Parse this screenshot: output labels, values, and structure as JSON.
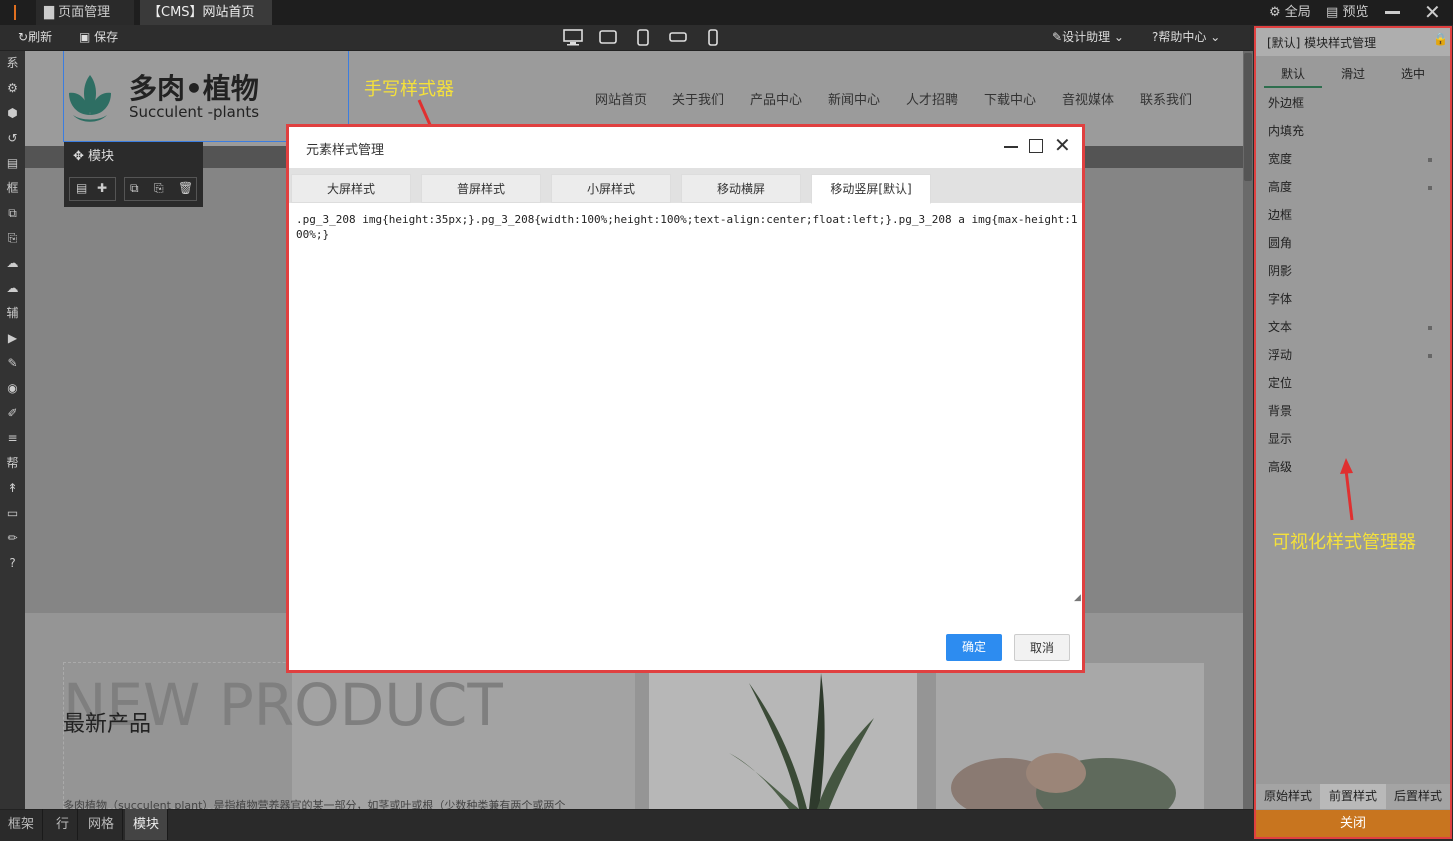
{
  "titlebar": {
    "tabs": [
      {
        "label": "页面管理",
        "icon": "file-icon"
      },
      {
        "label": "【CMS】网站首页",
        "icon": "close-circle-icon"
      }
    ],
    "global_label": "全局",
    "preview_label": "预览"
  },
  "toolbar": {
    "refresh_label": "刷新",
    "save_label": "保存",
    "design_assist_label": "设计助理",
    "help_center_label": "帮助中心",
    "devices": [
      "desktop-icon",
      "tablet-landscape-icon",
      "tablet-portrait-icon",
      "phone-landscape-icon",
      "phone-portrait-icon"
    ]
  },
  "leftbar": {
    "items": [
      "系",
      "⚙",
      "⬢",
      "↺",
      "▤",
      "框",
      "⧉",
      "⎘",
      "☁",
      "☁",
      "辅",
      "▶",
      "✎",
      "◉",
      "✐",
      "≡",
      "帮",
      "↟",
      "▭",
      "✏",
      "?"
    ]
  },
  "site": {
    "logo_title": "多肉•植物",
    "logo_subtitle": "Succulent -plants",
    "nav": [
      "网站首页",
      "关于我们",
      "产品中心",
      "新闻中心",
      "人才招聘",
      "下载中心",
      "音视媒体",
      "联系我们"
    ],
    "module_label": "模块",
    "new_product_en": "NEW PRODUCT",
    "new_product_cn": "最新产品",
    "desc_text": "多肉植物（succulent plant）是指植物营养器官的某一部分，如茎或叶或根（少数种类兼有两个或两个"
  },
  "annotations": {
    "handwritten": "手写样式器",
    "visual": "可视化样式管理器"
  },
  "dialog": {
    "title": "元素样式管理",
    "tabs": [
      "大屏样式",
      "普屏样式",
      "小屏样式",
      "移动横屏",
      "移动竖屏[默认]"
    ],
    "active_tab": 4,
    "css_text": ".pg_3_208 img{height:35px;}.pg_3_208{width:100%;height:100%;text-align:center;float:left;}.pg_3_208 a img{max-height:100%;}",
    "confirm_label": "确定",
    "cancel_label": "取消"
  },
  "rightpanel": {
    "title": "[默认] 模块样式管理",
    "state_tabs": [
      "默认",
      "滑过",
      "选中"
    ],
    "props": [
      "外边框",
      "内填充",
      "宽度",
      "高度",
      "边框",
      "圆角",
      "阴影",
      "字体",
      "文本",
      "浮动",
      "定位",
      "背景",
      "显示",
      "高级"
    ],
    "bottom_tabs": [
      "原始样式",
      "前置样式",
      "后置样式"
    ],
    "close_label": "关闭"
  },
  "bottombar": {
    "items": [
      "框架",
      "行",
      "网格",
      "模块"
    ]
  },
  "colors": {
    "accent_blue": "#2d8cf0",
    "highlight_red": "#e04040",
    "close_orange": "#c8751f",
    "annotation_yellow": "#f5e13a",
    "logo_green": "#2e6e63"
  }
}
